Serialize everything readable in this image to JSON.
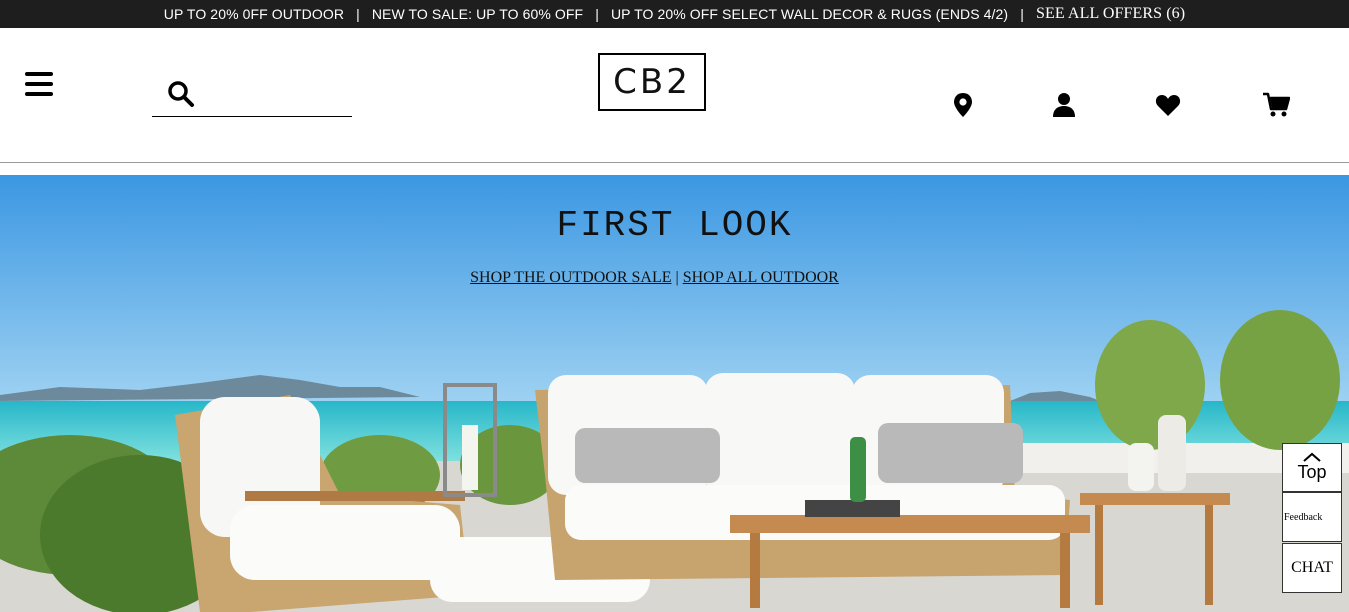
{
  "promo": {
    "items": [
      "UP TO 20% 0FF OUTDOOR",
      "NEW TO SALE: UP TO 60% OFF",
      "UP TO 20% OFF SELECT WALL DECOR & RUGS (ENDS 4/2)"
    ],
    "separator": "|",
    "see_all": "SEE ALL OFFERS (6)"
  },
  "header": {
    "logo": "CB2",
    "search_placeholder": "",
    "icons": [
      "menu-icon",
      "search-icon",
      "location-pin-icon",
      "account-icon",
      "heart-icon",
      "cart-icon"
    ]
  },
  "hero": {
    "title": "FIRST LOOK",
    "link_sale": "SHOP THE OUTDOOR SALE",
    "link_sep": "|",
    "link_all": "SHOP ALL OUTDOOR"
  },
  "side": {
    "top_label": "Top",
    "feedback_label": "Feedback",
    "chat_label": "CHAT"
  },
  "colors": {
    "promo_bg": "#1e1e1e",
    "sky": "#4aa4e4",
    "sea": "#30c4cf"
  }
}
